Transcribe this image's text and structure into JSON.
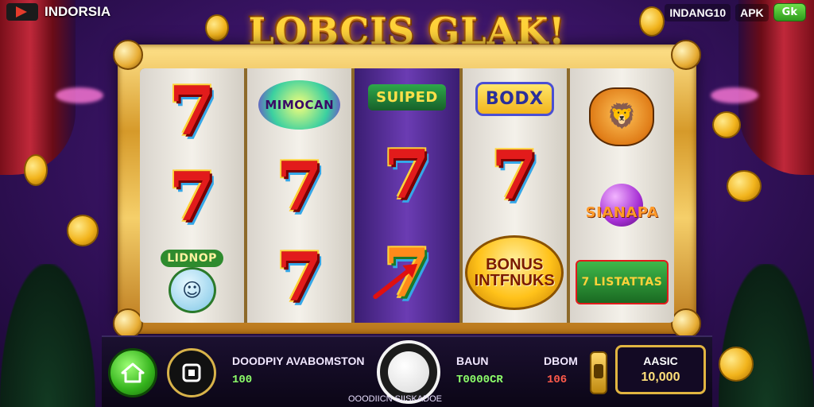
{
  "header": {
    "brand": "INDORSIA",
    "right_text": "INDANG10",
    "apk_label": "APK",
    "action_button": "Gk"
  },
  "game": {
    "title": "LOBCIS GLAK!"
  },
  "reels": [
    {
      "symbols": [
        "7",
        "7",
        "LIDNOP"
      ]
    },
    {
      "symbols": [
        "MIMOCAN",
        "7",
        "7"
      ]
    },
    {
      "symbols": [
        "SUIPED",
        "7",
        "7"
      ]
    },
    {
      "symbols": [
        "BODX",
        "7",
        "BONUS INTFNUKS"
      ]
    },
    {
      "symbols": [
        "lion",
        "SIANAPA",
        "7 LISTATTAS"
      ]
    }
  ],
  "bottom": {
    "win_label": "DOODPIY AVABOMSTON",
    "win_value": "100",
    "bet_label": "BAUN",
    "bet_value": "T0000CR",
    "spin_caption": "OOODIICN SIISKADOE",
    "dbom_label": "DBOM",
    "dbom_value": "106",
    "balance_label": "AASIC",
    "balance_value": "10,000"
  },
  "colors": {
    "gold": "#ffd23a",
    "seven_red": "#e21b1b",
    "accent_green": "#34b31c"
  },
  "icons": [
    "home-icon",
    "menu-icon",
    "spin-icon",
    "lever-icon",
    "logo-icon"
  ]
}
